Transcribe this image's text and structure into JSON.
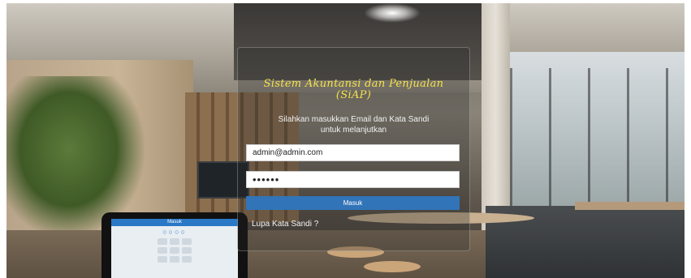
{
  "app": {
    "title_line1": "Sistem Akuntansi dan Penjualan",
    "title_line2": "(SiAP)",
    "subtitle_line1": "Silahkan masukkan Email dan Kata Sandi",
    "subtitle_line2": "untuk melanjutkan"
  },
  "form": {
    "email_value": "admin@admin.com",
    "password_value": "••••••",
    "submit_label": "Masuk",
    "forgot_label": "Lupa Kata Sandi ?"
  },
  "tablet": {
    "header": "Masuk",
    "dots": "○○○○"
  },
  "colors": {
    "title": "#f6e24a",
    "button": "#3174b8"
  }
}
